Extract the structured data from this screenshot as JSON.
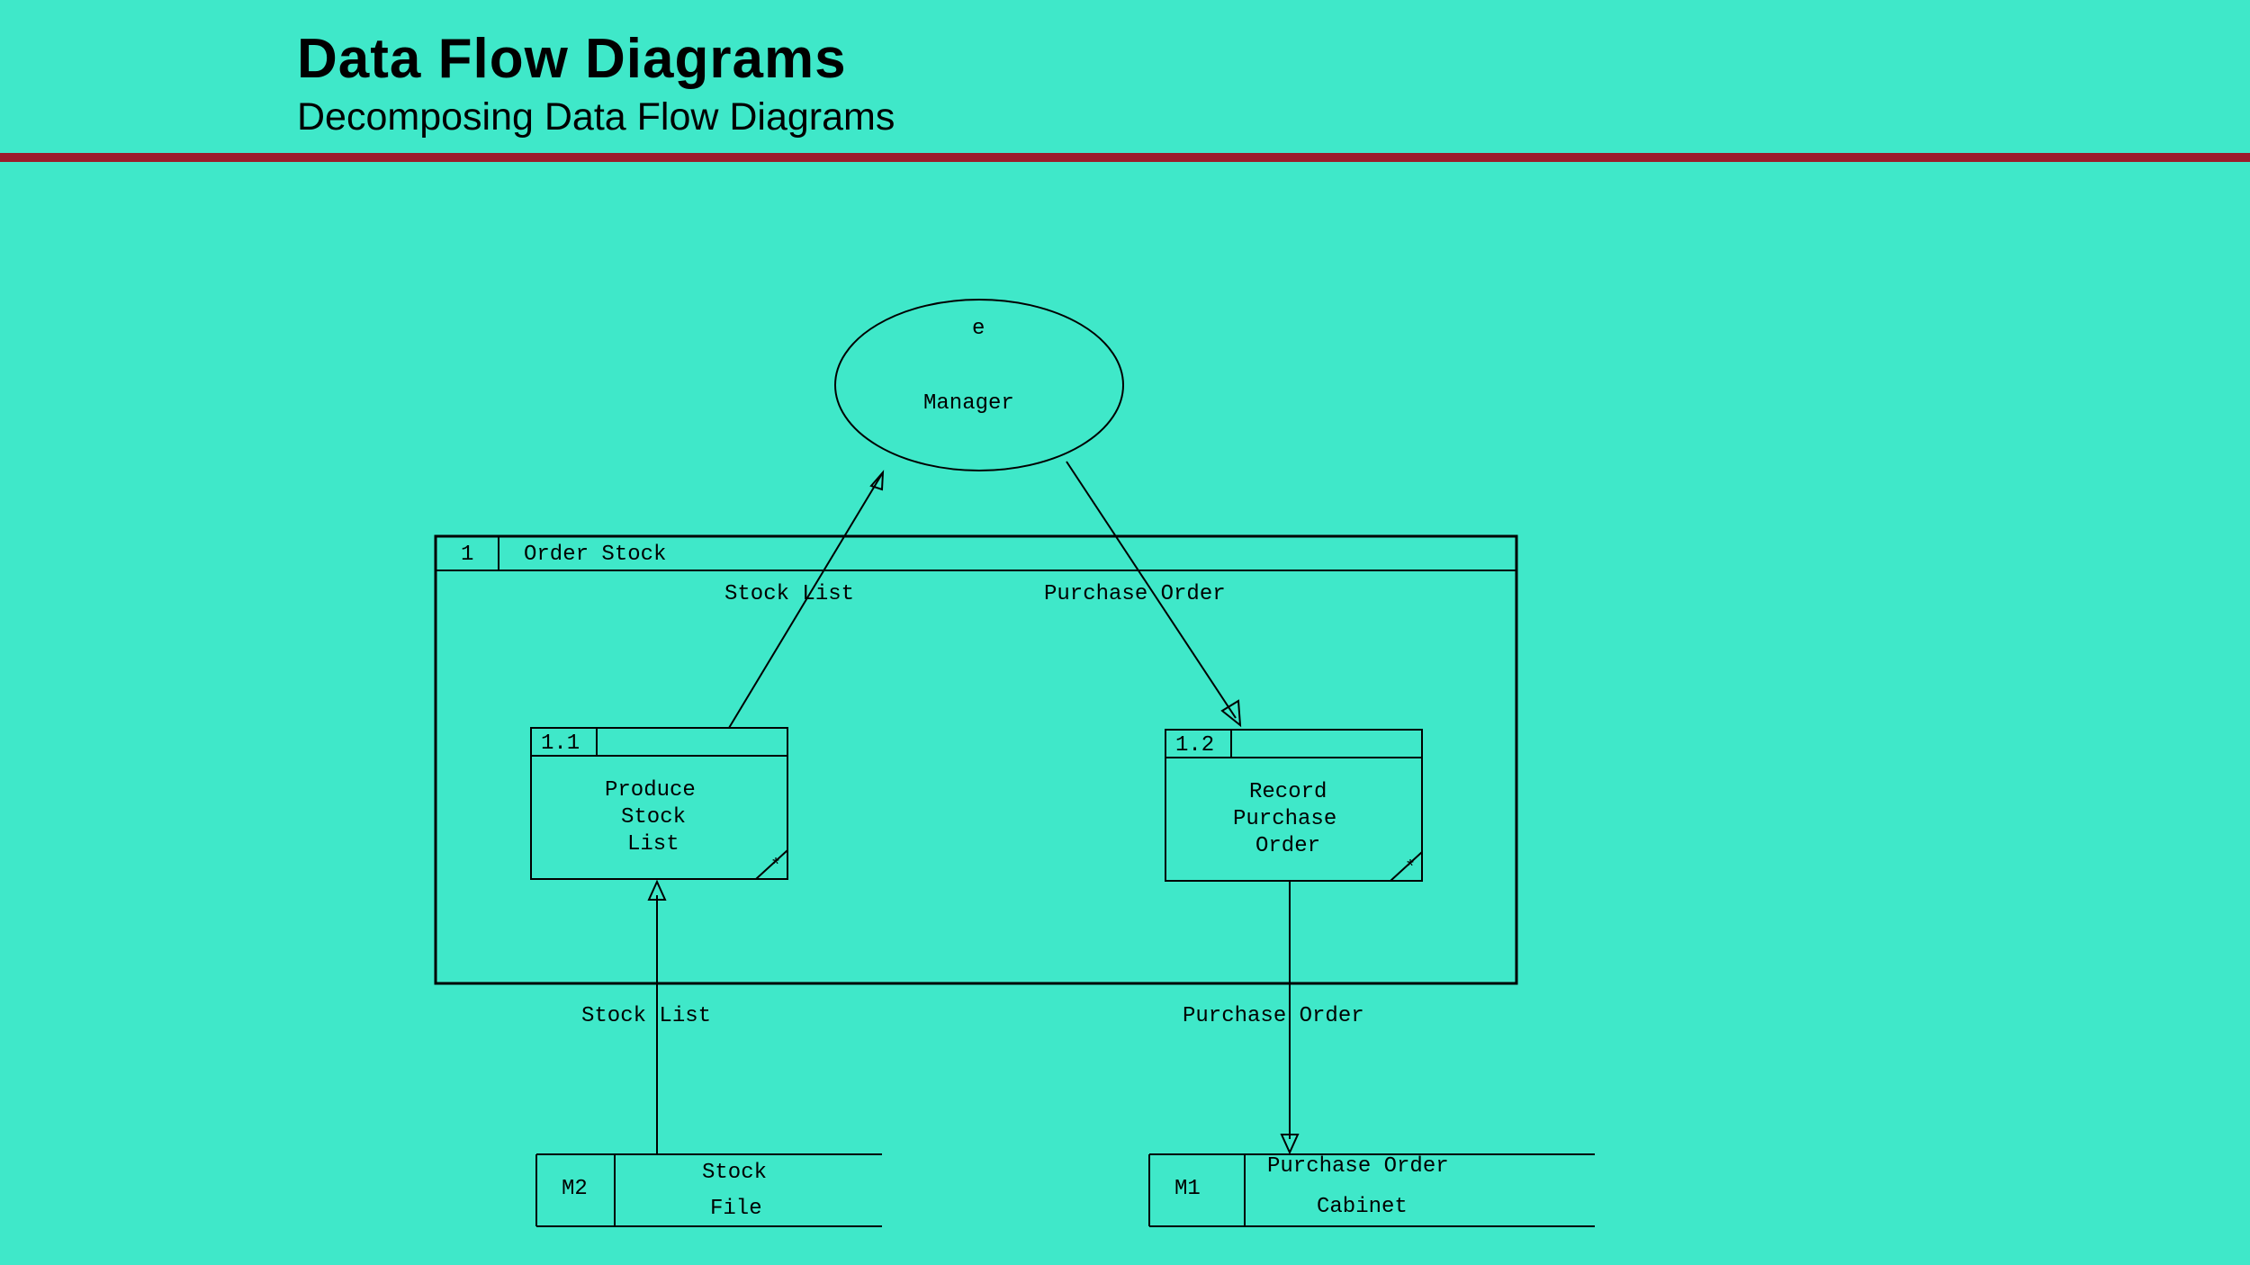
{
  "header": {
    "title": "Data Flow Diagrams",
    "subtitle": "Decomposing Data Flow Diagrams"
  },
  "diagram": {
    "external_entity": {
      "id": "e",
      "name": "Manager"
    },
    "parent_process": {
      "id": "1",
      "name": "Order Stock"
    },
    "processes": [
      {
        "id": "1.1",
        "name_line1": "Produce",
        "name_line2": "Stock",
        "name_line3": "List"
      },
      {
        "id": "1.2",
        "name_line1": "Record",
        "name_line2": "Purchase",
        "name_line3": "Order"
      }
    ],
    "datastores": [
      {
        "id": "M2",
        "name_line1": "Stock",
        "name_line2": "File"
      },
      {
        "id": "M1",
        "name_line1": "Purchase Order",
        "name_line2": "Cabinet"
      }
    ],
    "flows": {
      "stock_list_top": "Stock List",
      "purchase_order_top": "Purchase Order",
      "stock_list_bottom": "Stock List",
      "purchase_order_bottom": "Purchase Order"
    },
    "asterisk": "*"
  }
}
